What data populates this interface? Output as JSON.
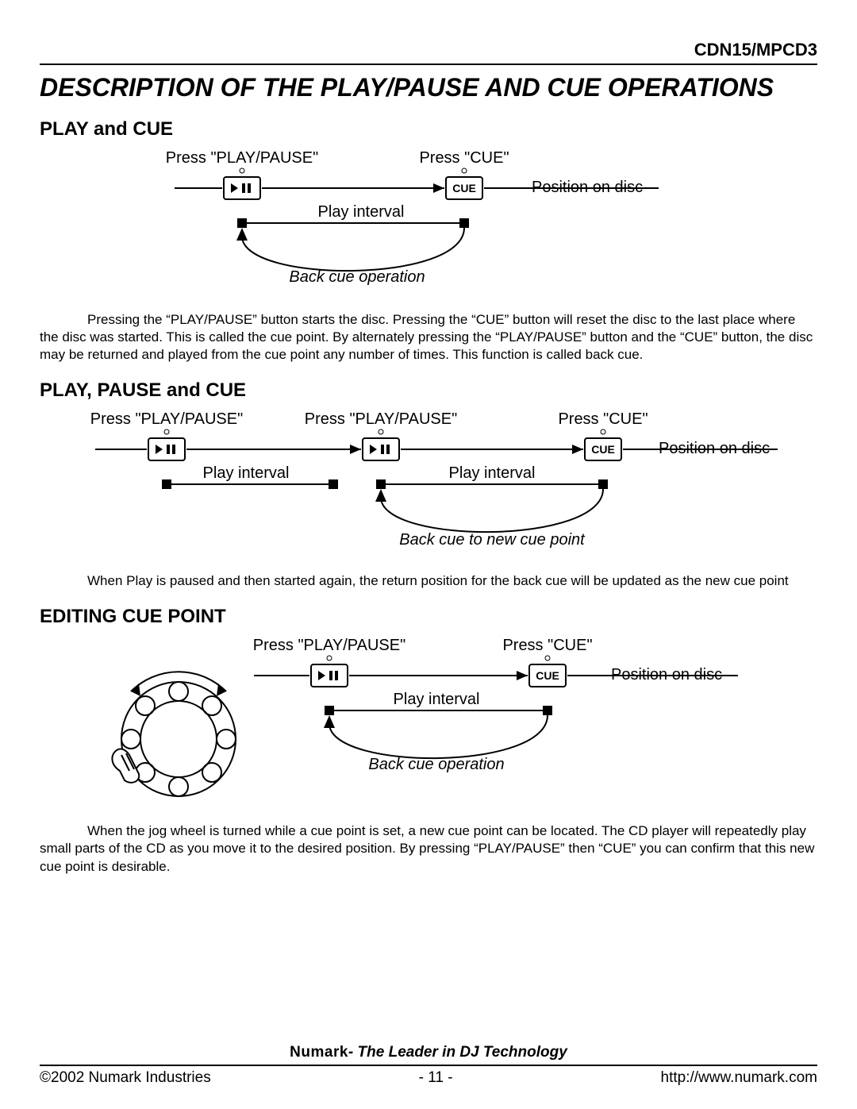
{
  "header": {
    "model": "CDN15/MPCD3"
  },
  "title": "DESCRIPTION OF THE PLAY/PAUSE AND CUE OPERATIONS",
  "sections": {
    "play_cue": {
      "heading": "PLAY and CUE",
      "press_play": "Press \"PLAY/PAUSE\"",
      "press_cue": "Press \"CUE\"",
      "position": "Position on disc",
      "play_interval": "Play interval",
      "back_cue": "Back cue operation",
      "cue_label": "CUE",
      "paragraph": "Pressing the “PLAY/PAUSE” button starts the disc. Pressing the “CUE” button will reset the disc to the last place where the disc was started.   This is called the cue point.  By alternately pressing the “PLAY/PAUSE” button and the “CUE” button, the disc may be returned and played from the cue point any number of times.  This function is called back cue."
    },
    "play_pause_cue": {
      "heading": "PLAY, PAUSE and CUE",
      "press_play": "Press \"PLAY/PAUSE\"",
      "press_cue": "Press \"CUE\"",
      "position": "Position on disc",
      "play_interval": "Play interval",
      "back_cue": "Back cue to new cue point",
      "cue_label": "CUE",
      "paragraph": "When Play is paused and then started again, the return position for the back cue will be updated as the new cue point"
    },
    "editing_cue": {
      "heading": "EDITING CUE POINT",
      "press_play": "Press \"PLAY/PAUSE\"",
      "press_cue": "Press \"CUE\"",
      "position": "Position on disc",
      "play_interval": "Play interval",
      "back_cue": "Back cue operation",
      "cue_label": "CUE",
      "paragraph": "When the jog wheel is turned while a cue point is set, a new cue point can be located.   The CD player will repeatedly play small parts of the CD as you move it to the desired position.  By pressing “PLAY/PAUSE” then “CUE” you can confirm that this new cue point is desirable."
    }
  },
  "footer": {
    "brand": "Numark",
    "tagline": "- The Leader in DJ Technology",
    "copyright": "©2002 Numark Industries",
    "page": "- 11 -",
    "url": "http://www.numark.com"
  }
}
